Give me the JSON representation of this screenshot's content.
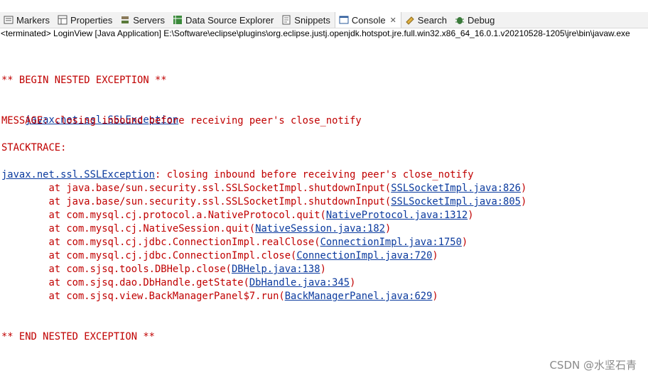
{
  "tabs": [
    {
      "label": "Markers",
      "icon": "markers-icon",
      "active": false
    },
    {
      "label": "Properties",
      "icon": "properties-icon",
      "active": false
    },
    {
      "label": "Servers",
      "icon": "servers-icon",
      "active": false
    },
    {
      "label": "Data Source Explorer",
      "icon": "data-source-icon",
      "active": false
    },
    {
      "label": "Snippets",
      "icon": "snippets-icon",
      "active": false
    },
    {
      "label": "Console",
      "icon": "console-icon",
      "active": true,
      "close": "✕"
    },
    {
      "label": "Search",
      "icon": "search-icon",
      "active": false
    },
    {
      "label": "Debug",
      "icon": "debug-icon",
      "active": false
    }
  ],
  "status_line": "<terminated> LoginView [Java Application] E:\\Software\\eclipse\\plugins\\org.eclipse.justj.openjdk.hotspot.jre.full.win32.x86_64_16.0.1.v20210528-1205\\jre\\bin\\javaw.exe",
  "console": {
    "begin": "** BEGIN NESTED EXCEPTION **",
    "exception_link": "javax.net.ssl.SSLException",
    "message": "MESSAGE: closing inbound before receiving peer's close_notify",
    "stacktrace_label": "STACKTRACE:",
    "trace_head_link": "javax.net.ssl.SSLException",
    "trace_head_text": ": closing inbound before receiving peer's close_notify",
    "frames": [
      {
        "prefix": "        at java.base/sun.security.ssl.SSLSocketImpl.shutdownInput(",
        "link": "SSLSocketImpl.java:826",
        "suffix": ")"
      },
      {
        "prefix": "        at java.base/sun.security.ssl.SSLSocketImpl.shutdownInput(",
        "link": "SSLSocketImpl.java:805",
        "suffix": ")"
      },
      {
        "prefix": "        at com.mysql.cj.protocol.a.NativeProtocol.quit(",
        "link": "NativeProtocol.java:1312",
        "suffix": ")"
      },
      {
        "prefix": "        at com.mysql.cj.NativeSession.quit(",
        "link": "NativeSession.java:182",
        "suffix": ")"
      },
      {
        "prefix": "        at com.mysql.cj.jdbc.ConnectionImpl.realClose(",
        "link": "ConnectionImpl.java:1750",
        "suffix": ")"
      },
      {
        "prefix": "        at com.mysql.cj.jdbc.ConnectionImpl.close(",
        "link": "ConnectionImpl.java:720",
        "suffix": ")"
      },
      {
        "prefix": "        at com.sjsq.tools.DBHelp.close(",
        "link": "DBHelp.java:138",
        "suffix": ")"
      },
      {
        "prefix": "        at com.sjsq.dao.DbHandle.getState(",
        "link": "DbHandle.java:345",
        "suffix": ")"
      },
      {
        "prefix": "        at com.sjsq.view.BackManagerPanel$7.run(",
        "link": "BackManagerPanel.java:629",
        "suffix": ")"
      }
    ],
    "end": "** END NESTED EXCEPTION **"
  },
  "watermark": "CSDN @水坚石青",
  "colors": {
    "error_text": "#c00000",
    "link": "#0a3a9e"
  }
}
